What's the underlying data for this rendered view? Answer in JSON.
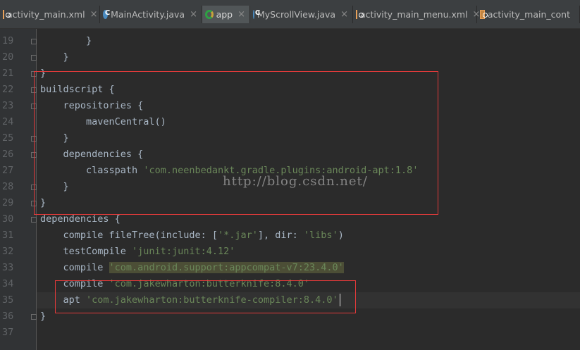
{
  "tabs": [
    {
      "label": "activity_main.xml",
      "icon": "xml-file-icon",
      "active": false,
      "close": "×"
    },
    {
      "label": "MainActivity.java",
      "icon": "java-class-icon",
      "active": false,
      "close": "×"
    },
    {
      "label": "app",
      "icon": "gradle-icon",
      "active": true,
      "close": "×"
    },
    {
      "label": "MyScrollView.java",
      "icon": "java-class-icon",
      "active": false,
      "close": "×"
    },
    {
      "label": "activity_main_menu.xml",
      "icon": "xml-file-icon",
      "active": false,
      "close": "×"
    },
    {
      "label": "activity_main_cont",
      "icon": "xml-file-icon",
      "active": false,
      "close": ""
    }
  ],
  "editor": {
    "lines": [
      {
        "num": "19",
        "segments": [
          {
            "t": "        }"
          }
        ]
      },
      {
        "num": "20",
        "segments": [
          {
            "t": "    }"
          }
        ]
      },
      {
        "num": "21",
        "segments": [
          {
            "t": "}"
          }
        ]
      },
      {
        "num": "22",
        "segments": [
          {
            "t": "buildscript {"
          }
        ]
      },
      {
        "num": "23",
        "segments": [
          {
            "t": "    repositories {"
          }
        ]
      },
      {
        "num": "24",
        "segments": [
          {
            "t": "        mavenCentral()"
          }
        ]
      },
      {
        "num": "25",
        "segments": [
          {
            "t": "    }"
          }
        ]
      },
      {
        "num": "26",
        "segments": [
          {
            "t": "    dependencies {"
          }
        ]
      },
      {
        "num": "27",
        "segments": [
          {
            "t": "        classpath "
          },
          {
            "t": "'com.neenbedankt.gradle.plugins:android-apt:1.8'",
            "c": "s"
          }
        ]
      },
      {
        "num": "28",
        "segments": [
          {
            "t": "    }"
          }
        ]
      },
      {
        "num": "29",
        "segments": [
          {
            "t": "}"
          }
        ]
      },
      {
        "num": "30",
        "segments": [
          {
            "t": "dependencies {"
          }
        ]
      },
      {
        "num": "31",
        "segments": [
          {
            "t": "    compile fileTree(include: ["
          },
          {
            "t": "'*.jar'",
            "c": "s"
          },
          {
            "t": "], dir: "
          },
          {
            "t": "'libs'",
            "c": "s"
          },
          {
            "t": ")"
          }
        ]
      },
      {
        "num": "32",
        "segments": [
          {
            "t": "    testCompile "
          },
          {
            "t": "'junit:junit:4.12'",
            "c": "s"
          }
        ]
      },
      {
        "num": "33",
        "segments": [
          {
            "t": "    compile "
          },
          {
            "t": "'com.android.support:appcompat-v7:23.4.0'",
            "c": "s hl"
          }
        ]
      },
      {
        "num": "34",
        "segments": [
          {
            "t": "    compile "
          },
          {
            "t": "'com.jakewharton:butterknife:8.4.0'",
            "c": "s"
          }
        ]
      },
      {
        "num": "35",
        "segments": [
          {
            "t": "    apt "
          },
          {
            "t": "'com.jakewharton:butterknife-compiler:8.4.0'",
            "c": "s"
          }
        ]
      },
      {
        "num": "36",
        "segments": [
          {
            "t": "}"
          }
        ]
      },
      {
        "num": "37",
        "segments": []
      }
    ],
    "fold_markers_at_lines": [
      "19",
      "20",
      "21",
      "22",
      "23",
      "25",
      "26",
      "28",
      "29",
      "30",
      "36"
    ]
  },
  "watermark": "http://blog.csdn.net/",
  "colors": {
    "background": "#2b2b2b",
    "gutter": "#313335",
    "text": "#a9b7c6",
    "string": "#6a8759",
    "line_number": "#606366",
    "highlight": "#4c4e36",
    "annotation_box": "#e23a3a"
  }
}
